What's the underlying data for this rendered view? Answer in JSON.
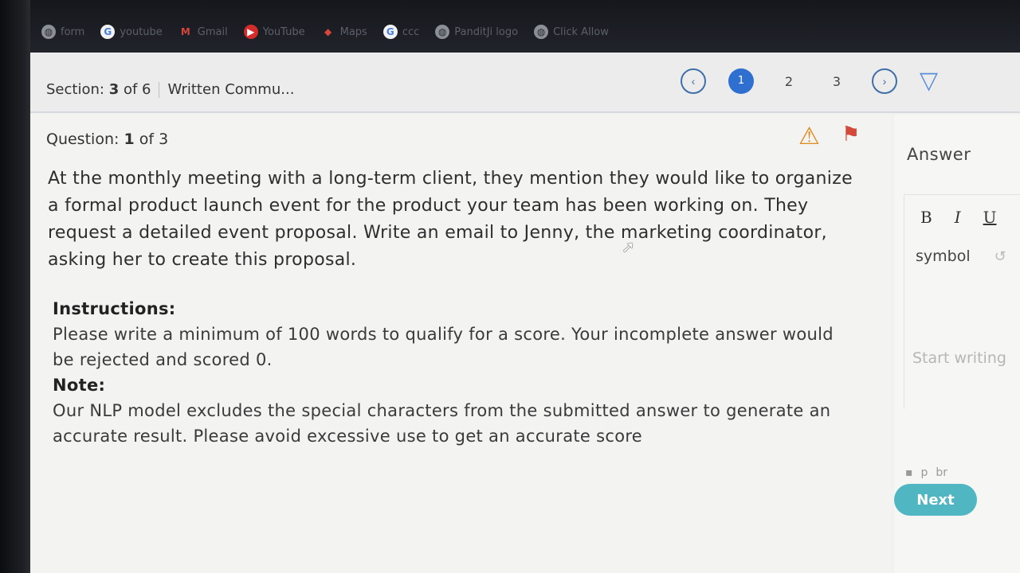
{
  "bookmarks": [
    {
      "label": "form",
      "icon": "globe-icon"
    },
    {
      "label": "youtube",
      "icon": "google-icon"
    },
    {
      "label": "Gmail",
      "icon": "gmail-icon"
    },
    {
      "label": "YouTube",
      "icon": "youtube-icon"
    },
    {
      "label": "Maps",
      "icon": "maps-icon"
    },
    {
      "label": "ccc",
      "icon": "google-icon"
    },
    {
      "label": "PanditJi logo",
      "icon": "globe-icon"
    },
    {
      "label": "Click Allow",
      "icon": "globe-icon"
    }
  ],
  "section": {
    "prefix": "Section:",
    "current": "3",
    "of_text": "of 6",
    "title": "Written Commu..."
  },
  "pager": {
    "prev_icon": "chevron-left-icon",
    "pages": [
      "1",
      "2",
      "3"
    ],
    "active_page": "1",
    "next_icon": "chevron-right-icon",
    "filter_icon": "filter-icon"
  },
  "question": {
    "prefix": "Question:",
    "current": "1",
    "of_text": "of 3",
    "body": "At the monthly meeting with a long-term client, they mention they would like to organize a formal product launch event for the product your team has been working on. They request a detailed event proposal. Write an email to Jenny, the marketing coordinator, asking her to create this proposal.",
    "instructions_label": "Instructions:",
    "instructions_text": "Please write a minimum of 100 words to qualify for a score. Your incomplete answer would be rejected and scored 0.",
    "note_label": "Note:",
    "note_text": "Our NLP model excludes the special characters from the submitted answer to generate an accurate result. Please avoid excessive use to get an accurate score"
  },
  "answer": {
    "title": "Answer",
    "bold_label": "B",
    "italic_label": "I",
    "underline_label": "U",
    "symbol_label": "symbol",
    "placeholder": "Start writing",
    "status_p": "p",
    "status_br": "br"
  },
  "next_label": "Next",
  "colors": {
    "accent_blue": "#2f6fd0",
    "next_button": "#4fb6c2",
    "warning": "#e08a1d",
    "flag": "#d44a3a"
  }
}
